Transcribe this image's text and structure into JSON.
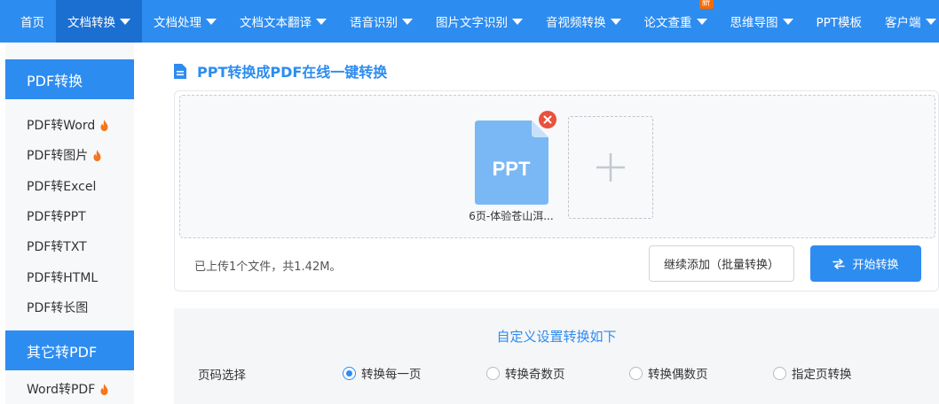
{
  "nav": {
    "items": [
      {
        "label": "首页",
        "caret": false
      },
      {
        "label": "文档转换",
        "caret": true,
        "active": true
      },
      {
        "label": "文档处理",
        "caret": true
      },
      {
        "label": "文档文本翻译",
        "caret": true
      },
      {
        "label": "语音识别",
        "caret": true
      },
      {
        "label": "图片文字识别",
        "caret": true
      },
      {
        "label": "音视频转换",
        "caret": true
      },
      {
        "label": "论文查重",
        "caret": true,
        "badge": "新"
      },
      {
        "label": "思维导图",
        "caret": true
      },
      {
        "label": "PPT模板",
        "caret": false
      },
      {
        "label": "客户端",
        "caret": true
      }
    ]
  },
  "sidebar": {
    "section1": "PDF转换",
    "items1": [
      {
        "label": "PDF转Word",
        "hot": true
      },
      {
        "label": "PDF转图片",
        "hot": true
      },
      {
        "label": "PDF转Excel",
        "hot": false
      },
      {
        "label": "PDF转PPT",
        "hot": false
      },
      {
        "label": "PDF转TXT",
        "hot": false
      },
      {
        "label": "PDF转HTML",
        "hot": false
      },
      {
        "label": "PDF转长图",
        "hot": false
      }
    ],
    "section2": "其它转PDF",
    "items2": [
      {
        "label": "Word转PDF",
        "hot": true
      }
    ]
  },
  "page_title": "PPT转换成PDF在线一键转换",
  "upload": {
    "file": {
      "type_label": "PPT",
      "name": "6页-体验苍山洱..."
    },
    "status": "已上传1个文件，共1.42M。",
    "add_more_label": "继续添加（批量转换）",
    "start_label": "开始转换"
  },
  "settings": {
    "title": "自定义设置转换如下",
    "page_select_label": "页码选择",
    "options": [
      {
        "label": "转换每一页",
        "checked": true
      },
      {
        "label": "转换奇数页",
        "checked": false
      },
      {
        "label": "转换偶数页",
        "checked": false
      },
      {
        "label": "指定页转换",
        "checked": false
      }
    ]
  },
  "colors": {
    "primary": "#2d8cf0",
    "active_nav": "#1b6fd1",
    "remove": "#e9523d",
    "file_icon": "#7ab8f5",
    "fire": "#f5761b"
  }
}
